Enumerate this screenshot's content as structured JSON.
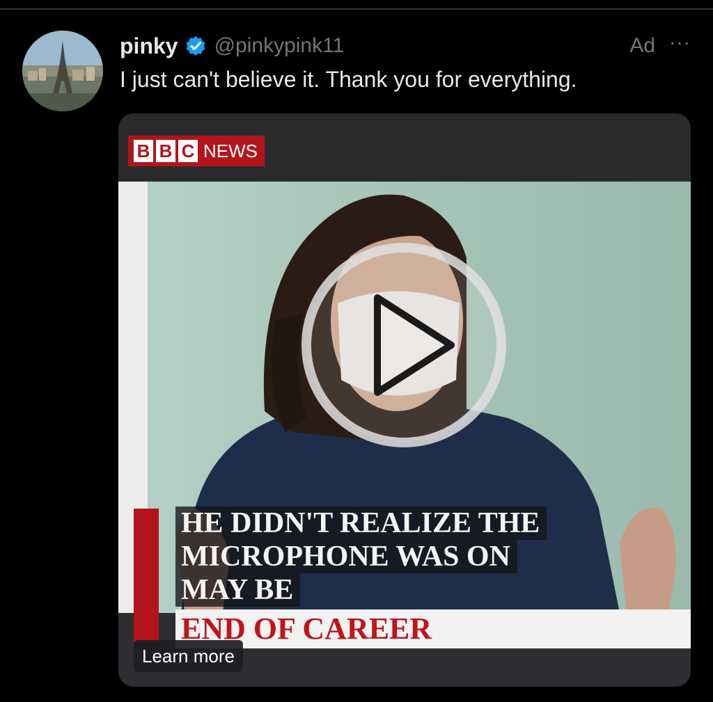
{
  "tweet": {
    "author": {
      "display_name": "pinky",
      "handle": "@pinkypink11",
      "verified": true,
      "avatar_icon": "eiffel-tower-photo"
    },
    "ad_label": "Ad",
    "more_label": "···",
    "text": "I just can't believe it. Thank you for everything.",
    "media": {
      "logo": {
        "letters": [
          "B",
          "B",
          "C"
        ],
        "suffix": "NEWS"
      },
      "headline_lines": [
        "HE DIDN'T REALIZE THE",
        "MICROPHONE WAS ON",
        "MAY BE"
      ],
      "banner": "END OF CAREER",
      "play_icon": "play-circle-icon",
      "cta": "Learn more"
    }
  },
  "colors": {
    "background": "#000000",
    "text_primary": "#e7e9ea",
    "text_secondary": "#71767b",
    "verified_blue": "#1d9bf0",
    "bbc_red": "#b3141b"
  }
}
